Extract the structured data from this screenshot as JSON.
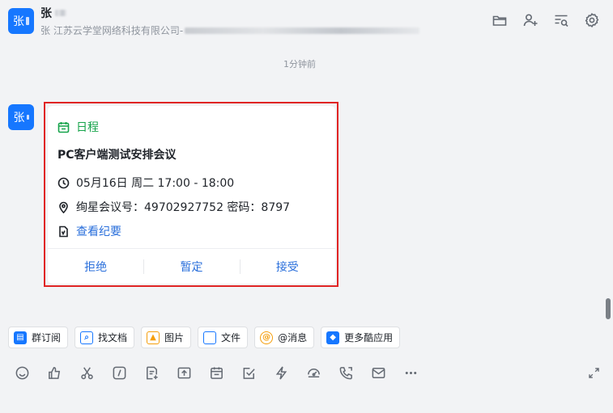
{
  "header": {
    "avatar_text": "张",
    "name": "张",
    "subtitle": "张  江苏云学堂网络科技有限公司-"
  },
  "timestamp": "1分钟前",
  "message": {
    "avatar_text": "张",
    "card": {
      "tag": "日程",
      "title": "PC客户端测试安排会议",
      "time": "05月16日 周二 17:00 - 18:00",
      "room": "绚星会议号：49702927752 密码：8797",
      "link": "查看纪要",
      "actions": [
        "拒绝",
        "暂定",
        "接受"
      ]
    }
  },
  "quick_apps": [
    {
      "label": "群订阅",
      "icon": "subscribe-icon",
      "color": "#1677ff"
    },
    {
      "label": "找文档",
      "icon": "find-doc-icon",
      "color": "#1677ff"
    },
    {
      "label": "图片",
      "icon": "image-icon",
      "color": "#f59e0b"
    },
    {
      "label": "文件",
      "icon": "folder-icon",
      "color": "#1677ff"
    },
    {
      "label": "@消息",
      "icon": "at-icon",
      "color": "#f59e0b"
    },
    {
      "label": "更多酷应用",
      "icon": "apps-icon",
      "color": "#1677ff"
    }
  ],
  "colors": {
    "accent": "#1677ff",
    "tag_green": "#15a34a",
    "link_blue": "#2a6fdb",
    "highlight_red": "#e02424"
  }
}
